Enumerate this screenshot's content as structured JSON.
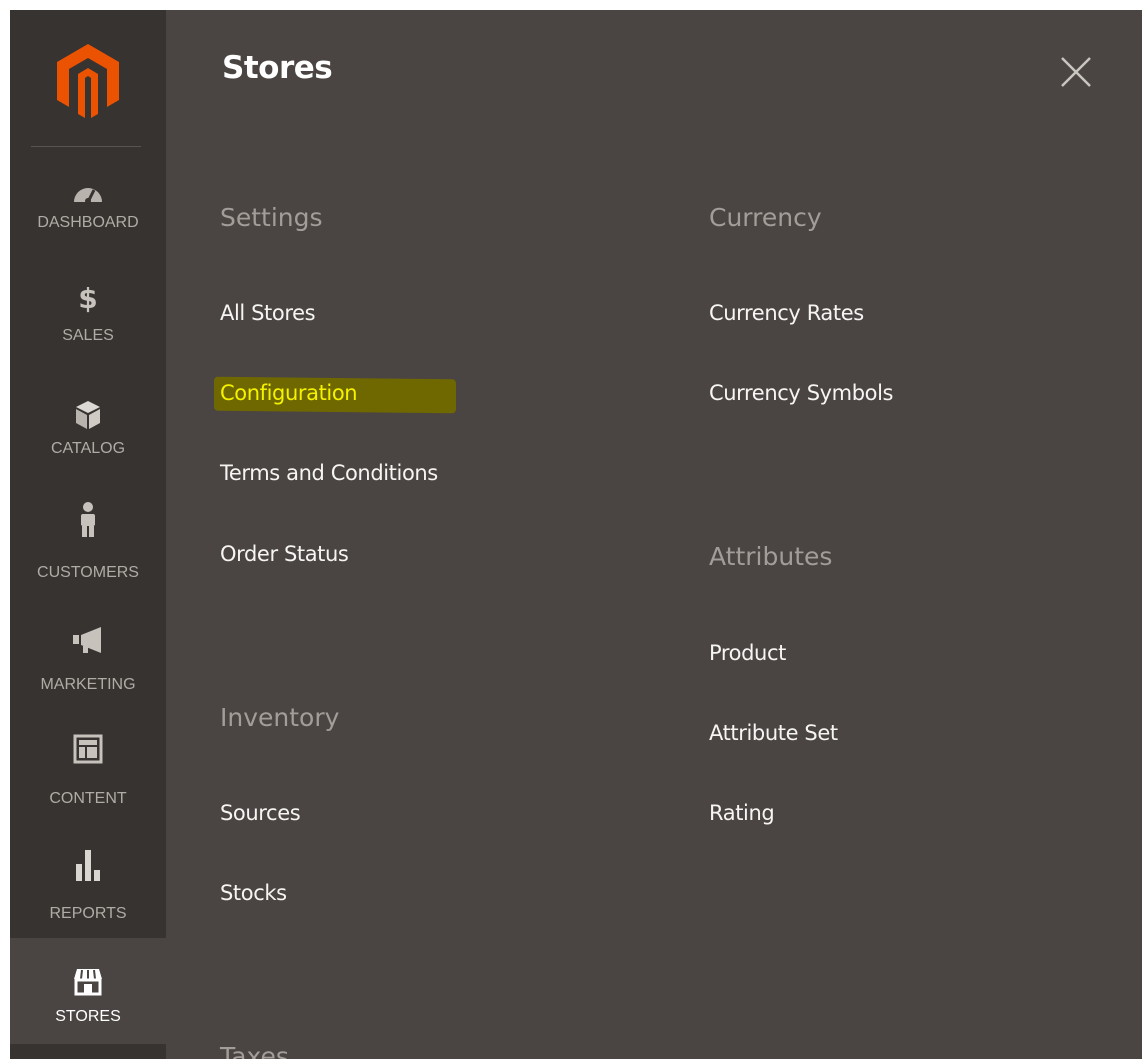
{
  "sidebar": {
    "items": [
      {
        "label": "DASHBOARD",
        "icon": "dashboard-gauge-icon"
      },
      {
        "label": "$",
        "icon": "dollar-icon"
      },
      {
        "label": "SALES",
        "icon": "dollar-icon"
      },
      {
        "label": "CATALOG",
        "icon": "box-icon"
      },
      {
        "label": "CUSTOMERS",
        "icon": "person-icon"
      },
      {
        "label": "MARKETING",
        "icon": "megaphone-icon"
      },
      {
        "label": "CONTENT",
        "icon": "layout-icon"
      },
      {
        "label": "REPORTS",
        "icon": "bar-chart-icon"
      },
      {
        "label": "STORES",
        "icon": "storefront-icon"
      }
    ],
    "active": "STORES"
  },
  "panel": {
    "title": "Stores",
    "close_icon": "close-icon",
    "groups": [
      {
        "title": "Settings",
        "links": [
          "All Stores",
          "Configuration",
          "Terms and Conditions",
          "Order Status"
        ]
      },
      {
        "title": "Inventory",
        "links": [
          "Sources",
          "Stocks"
        ]
      },
      {
        "title": "Taxes",
        "links": []
      },
      {
        "title": "Currency",
        "links": [
          "Currency Rates",
          "Currency Symbols"
        ]
      },
      {
        "title": "Attributes",
        "links": [
          "Product",
          "Attribute Set",
          "Rating"
        ]
      }
    ],
    "highlighted_link": "Configuration"
  },
  "colors": {
    "sidebar_bg": "#373330",
    "panel_bg": "#4a4542",
    "logo_orange": "#eb5202",
    "highlight_text": "#f5f200",
    "highlight_bg": "#6f6800"
  }
}
